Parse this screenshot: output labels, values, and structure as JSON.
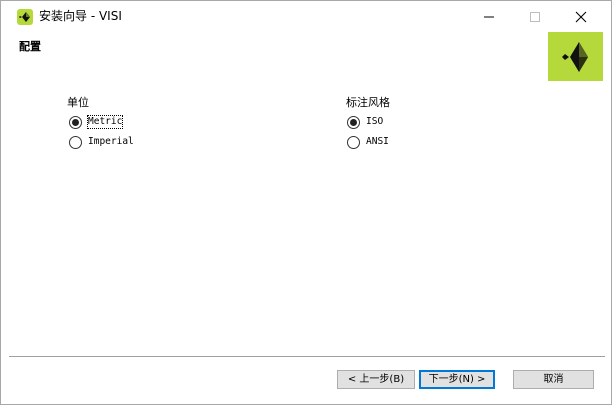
{
  "window": {
    "title": "安装向导 - VISI",
    "minimize_glyph": "—",
    "maximize_glyph": "☐",
    "close_glyph": "✕"
  },
  "page": {
    "title": "配置"
  },
  "units": {
    "label": "单位",
    "options": [
      {
        "label": "Metric",
        "checked": true
      },
      {
        "label": "Imperial",
        "checked": false
      }
    ]
  },
  "dimension_style": {
    "label": "标注风格",
    "options": [
      {
        "label": "ISO",
        "checked": true
      },
      {
        "label": "ANSI",
        "checked": false
      }
    ]
  },
  "footer": {
    "back_label": "< 上一步(B)",
    "next_label": "下一步(N) >",
    "cancel_label": "取消"
  },
  "colors": {
    "brand": "#b5d93a",
    "focus": "#0078d7"
  }
}
